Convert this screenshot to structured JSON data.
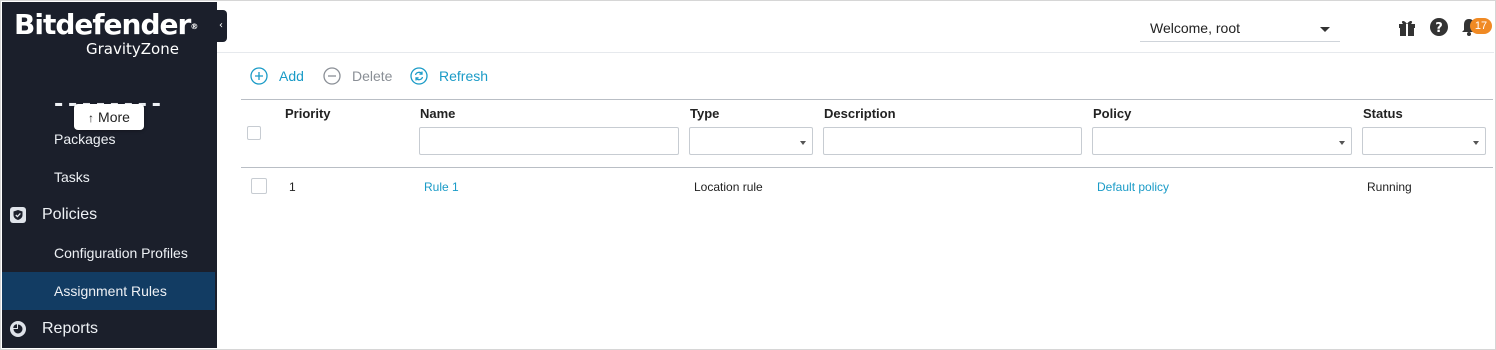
{
  "brand": {
    "name": "Bitdefender",
    "reg": "®",
    "product": "GravityZone"
  },
  "sidebar": {
    "more_label": "More",
    "items": [
      {
        "label": "Packages",
        "type": "sub"
      },
      {
        "label": "Tasks",
        "type": "sub"
      },
      {
        "label": "Policies",
        "type": "main",
        "icon": "shield-icon"
      },
      {
        "label": "Configuration Profiles",
        "type": "sub"
      },
      {
        "label": "Assignment Rules",
        "type": "sub",
        "active": true
      },
      {
        "label": "Reports",
        "type": "main",
        "icon": "reports-icon"
      }
    ]
  },
  "header": {
    "welcome": "Welcome, root",
    "notifications_count": "17",
    "icons": [
      "gift-icon",
      "help-icon",
      "bell-icon"
    ]
  },
  "toolbar": {
    "add": "Add",
    "delete": "Delete",
    "refresh": "Refresh"
  },
  "table": {
    "columns": [
      "Priority",
      "Name",
      "Type",
      "Description",
      "Policy",
      "Status"
    ],
    "rows": [
      {
        "priority": "1",
        "name": "Rule 1",
        "type": "Location rule",
        "description": "",
        "policy": "Default policy",
        "status": "Running"
      }
    ]
  },
  "colors": {
    "sidebar_bg": "#1b1f2b",
    "active_item": "#123c63",
    "accent": "#1a9bc7",
    "badge": "#f08a24"
  }
}
